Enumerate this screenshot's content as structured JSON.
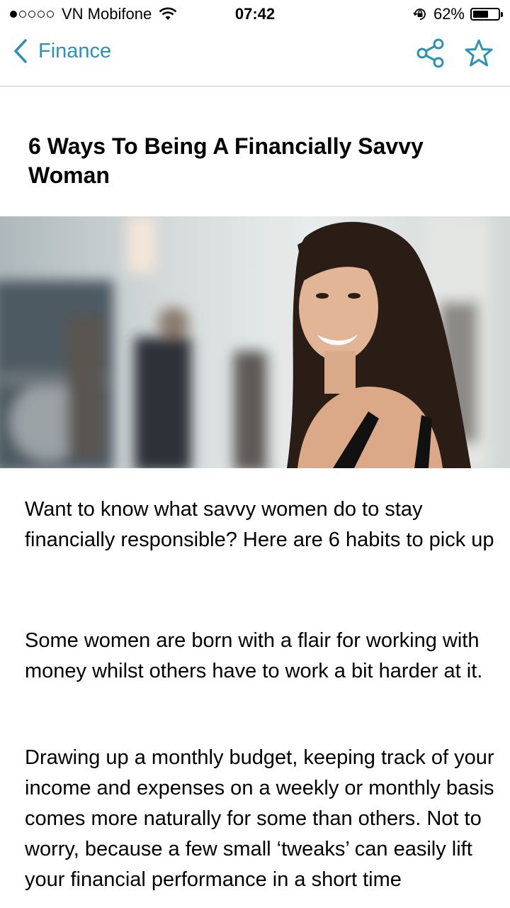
{
  "status_bar": {
    "signal_bars": 5,
    "signal_active": 1,
    "carrier": "VN Mobifone",
    "time": "07:42",
    "battery": "62%",
    "battery_level": 0.62
  },
  "nav": {
    "back_label": "Finance",
    "accent_color": "#2a93b5",
    "icons": [
      "chevron-left-icon",
      "share-icon",
      "star-icon"
    ]
  },
  "article": {
    "title": "6 Ways To Being A Financially Savvy Woman",
    "paragraphs": [
      "Want to know what savvy women do to stay financially responsible? Here are 6 habits to pick up",
      "Some women are born with a flair for working with money whilst others have to work a bit harder at it.",
      "Drawing up a monthly budget, keeping track of your income and expenses on a weekly or monthly basis comes more naturally for some than others. Not to worry, because a few small ‘tweaks’ can easily lift your financial performance in a short time"
    ]
  }
}
